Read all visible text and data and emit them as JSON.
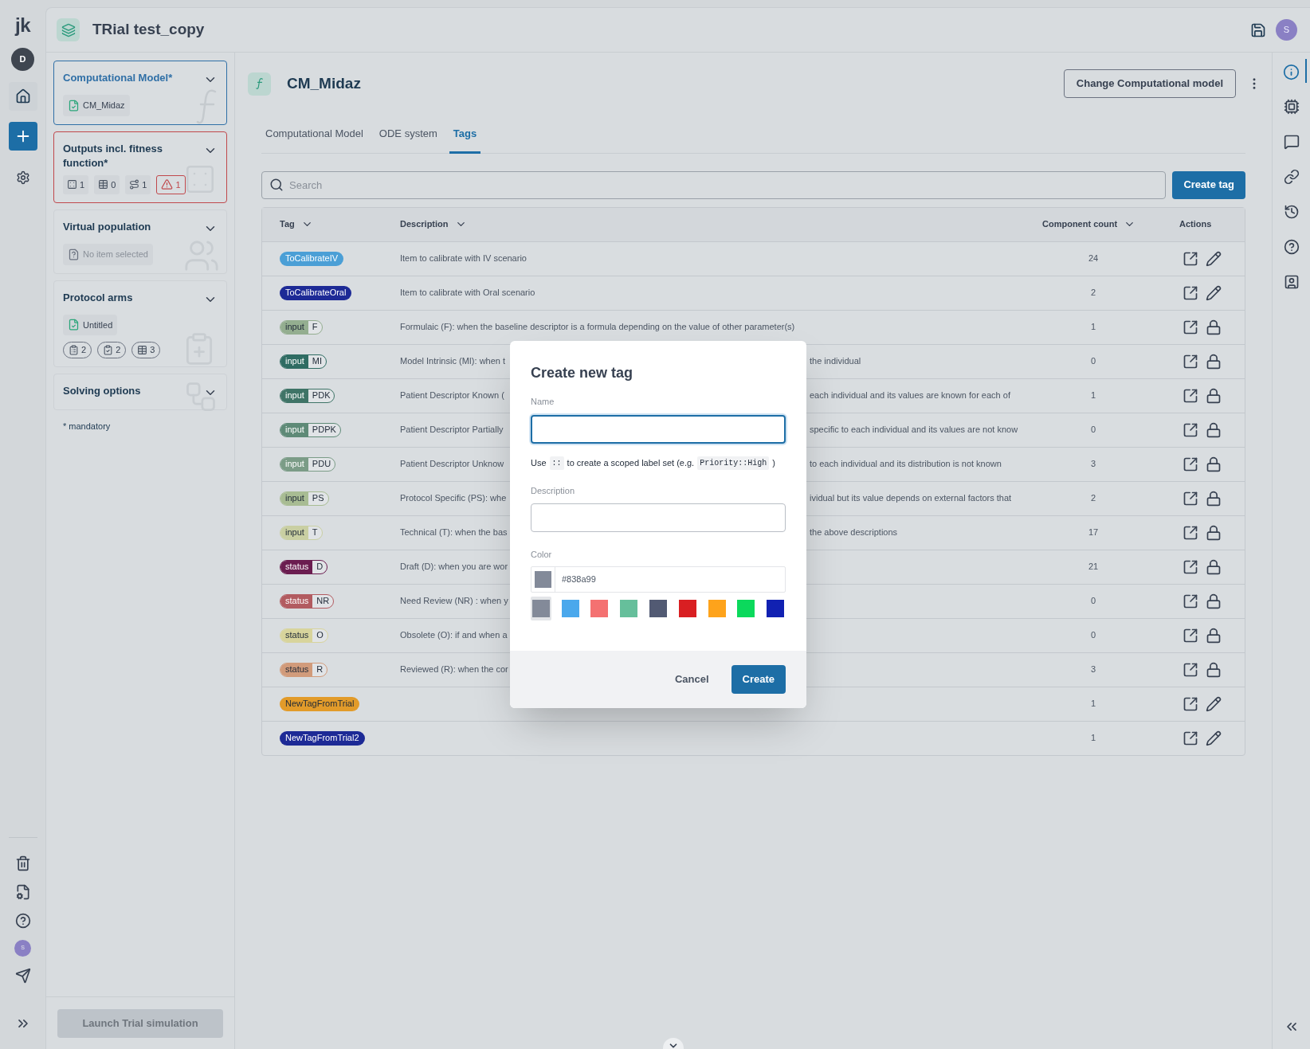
{
  "rail": {
    "logo": "jk",
    "avatar": "D",
    "bottom_avatar": "S"
  },
  "header": {
    "title": "TRial test_copy",
    "avatar": "S"
  },
  "sidebar": {
    "cards": [
      {
        "title": "Computational Model*",
        "selected": true,
        "error": false,
        "expanded": true,
        "chip": {
          "label": "CM_Midaz",
          "kind": "item"
        }
      },
      {
        "title": "Outputs incl. fitness function*",
        "selected": false,
        "error": true,
        "expanded": true,
        "counts": [
          {
            "value": "1",
            "kind": "dice"
          },
          {
            "value": "0",
            "kind": "table"
          },
          {
            "value": "1",
            "kind": "route"
          },
          {
            "value": "1",
            "kind": "warning"
          }
        ]
      },
      {
        "title": "Virtual population",
        "selected": false,
        "error": false,
        "expanded": true,
        "chip": {
          "label": "No item selected",
          "kind": "empty"
        }
      },
      {
        "title": "Protocol arms",
        "selected": false,
        "error": false,
        "expanded": true,
        "chip": {
          "label": "Untitled",
          "kind": "item"
        },
        "pills": [
          {
            "value": "2",
            "kind": "clipboard"
          },
          {
            "value": "2",
            "kind": "check"
          },
          {
            "value": "3",
            "kind": "table"
          }
        ]
      },
      {
        "title": "Solving options",
        "selected": false,
        "error": false,
        "expanded": true
      }
    ],
    "note": "* mandatory",
    "launch_button": {
      "label": "Launch Trial simulation",
      "disabled": true
    }
  },
  "model": {
    "title": "CM_Midaz",
    "change_button": "Change Computational model"
  },
  "tabs": [
    {
      "label": "Computational Model",
      "selected": false
    },
    {
      "label": "ODE system",
      "selected": false
    },
    {
      "label": "Tags",
      "selected": true
    }
  ],
  "search": {
    "placeholder": "Search"
  },
  "create_tag_button": "Create tag",
  "table": {
    "columns": [
      "Tag",
      "Description",
      "Component count",
      "Actions"
    ],
    "rows": [
      {
        "tag": {
          "kind": "simple",
          "label": "ToCalibrateIV",
          "color": "#4b9fd6"
        },
        "description": "Item to calibrate with IV scenario",
        "count": "24",
        "editable": true
      },
      {
        "tag": {
          "kind": "simple",
          "label": "ToCalibrateOral",
          "color": "#1d2a96"
        },
        "description": "Item to calibrate with Oral scenario",
        "count": "2",
        "editable": true
      },
      {
        "tag": {
          "kind": "scoped",
          "scope": "input",
          "label": "F",
          "color": "#94ae90"
        },
        "description": "Formulaic (F): when the baseline descriptor is a formula depending on the value of other parameter(s)",
        "count": "1",
        "editable": false
      },
      {
        "tag": {
          "kind": "scoped",
          "scope": "input",
          "label": "MI",
          "color": "#2f6c63"
        },
        "description": "Model Intrinsic (MI): when t",
        "description_tail": "the individual",
        "count": "0",
        "editable": false
      },
      {
        "tag": {
          "kind": "scoped",
          "scope": "input",
          "label": "PDK",
          "color": "#3f7467"
        },
        "description": "Patient Descriptor Known (",
        "description_tail": "each individual and its values are known for each of",
        "count": "1",
        "editable": false
      },
      {
        "tag": {
          "kind": "scoped",
          "scope": "input",
          "label": "PDPK",
          "color": "#5e8a77"
        },
        "description": "Patient Descriptor Partially",
        "description_tail": "specific to each individual and its values are not know",
        "count": "0",
        "editable": false
      },
      {
        "tag": {
          "kind": "scoped",
          "scope": "input",
          "label": "PDU",
          "color": "#7b9c87"
        },
        "description": "Patient Descriptor Unknow",
        "description_tail": "to each individual and its distribution is not known",
        "count": "3",
        "editable": false
      },
      {
        "tag": {
          "kind": "scoped",
          "scope": "input",
          "label": "PS",
          "color": "#a8bc93"
        },
        "description": "Protocol Specific (PS): whe",
        "description_tail": "ividual but its value depends on external factors that",
        "count": "2",
        "editable": false
      },
      {
        "tag": {
          "kind": "scoped",
          "scope": "input",
          "label": "T",
          "color": "#c9cfa2"
        },
        "description": "Technical (T): when the bas",
        "description_tail": "the above descriptions",
        "count": "17",
        "editable": false
      },
      {
        "tag": {
          "kind": "scoped",
          "scope": "status",
          "label": "D",
          "color": "#6b1d50"
        },
        "description": "Draft (D): when you are wor",
        "count": "21",
        "editable": false
      },
      {
        "tag": {
          "kind": "scoped",
          "scope": "status",
          "label": "NR",
          "color": "#b25b60"
        },
        "description": "Need Review (NR) : when y",
        "count": "0",
        "editable": false
      },
      {
        "tag": {
          "kind": "scoped",
          "scope": "status",
          "label": "O",
          "color": "#d8d49c"
        },
        "description": "Obsolete (O): if and when a",
        "count": "0",
        "editable": false
      },
      {
        "tag": {
          "kind": "scoped",
          "scope": "status",
          "label": "R",
          "color": "#d19b7b"
        },
        "description": "Reviewed (R): when the cor",
        "count": "3",
        "editable": false
      },
      {
        "tag": {
          "kind": "simple",
          "label": "NewTagFromTrial",
          "color": "#e29b2a"
        },
        "count": "1",
        "editable": true
      },
      {
        "tag": {
          "kind": "simple",
          "label": "NewTagFromTrial2",
          "color": "#1d2a96"
        },
        "count": "1",
        "editable": true
      }
    ]
  },
  "dialog": {
    "title": "Create new tag",
    "name_label": "Name",
    "hint": [
      {
        "kind": "text",
        "text": "Use"
      },
      {
        "kind": "code",
        "text": "::"
      },
      {
        "kind": "text",
        "text": "to create a scoped label set (e.g."
      },
      {
        "kind": "code",
        "text": "Priority::High"
      },
      {
        "kind": "text",
        "text": ")"
      }
    ],
    "description_label": "Description",
    "color_label": "Color",
    "color_value": "#838a99",
    "swatches": [
      {
        "color": "#838a99",
        "selected": true
      },
      {
        "color": "#4aa8ec",
        "selected": false
      },
      {
        "color": "#f47171",
        "selected": false
      },
      {
        "color": "#66bf9b",
        "selected": false
      },
      {
        "color": "#525a73",
        "selected": false
      },
      {
        "color": "#d91f22",
        "selected": false
      },
      {
        "color": "#fea31b",
        "selected": false
      },
      {
        "color": "#0bd95c",
        "selected": false
      },
      {
        "color": "#1121b2",
        "selected": false
      }
    ],
    "cancel": "Cancel",
    "create": "Create"
  }
}
